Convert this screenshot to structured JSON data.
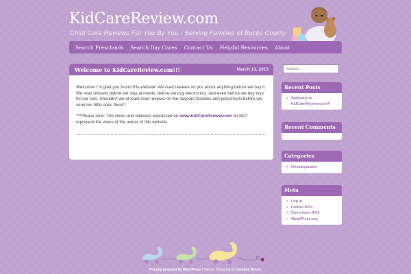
{
  "site": {
    "title": "KidCareReview.com",
    "tagline": "Child Care Reviews For You By You - Serving Families of Bucks County"
  },
  "nav": {
    "items": [
      "Search Preschools",
      "Search Day Cares",
      "Contact Us",
      "Helpful Resources",
      "About"
    ]
  },
  "post": {
    "title": "Welcome to KidCareReview.com!!!",
    "date": "March 13, 2013",
    "paragraph1": "Welcome! I'm glad you found this website! We read reviews on just about anything before we buy it. We read reviews before we stay at hotels, before we buy electronics, and even before we buy toys for our kids. Shouldn't we at least read reviews on the daycare facilities and preschools before we send our little ones there?",
    "note_prefix": "***Please note: The views and opinions expressed on ",
    "note_link": "www.KidCareReview.com",
    "note_suffix": " do NOT represent the views of the owner of this website."
  },
  "sidebar": {
    "search_placeholder": "Search ...",
    "recent_posts": {
      "title": "Recent Posts",
      "items": [
        "Welcome to KidCareReview.com!!!"
      ]
    },
    "recent_comments": {
      "title": "Recent Comments"
    },
    "categories": {
      "title": "Categories",
      "items": [
        "Uncategorized"
      ]
    },
    "meta": {
      "title": "Meta",
      "items": [
        "Log in",
        "Entries RSS",
        "Comments RSS",
        "WordPress.org"
      ]
    }
  },
  "footer": {
    "powered": "Proudly powered by WordPress",
    "theme_prefix": " | Theme: Babyslog by ",
    "author": "Caroline Moore."
  },
  "colors": {
    "background": "#bfa2cf",
    "accent": "#9d68b5",
    "link": "#7a3a96"
  }
}
